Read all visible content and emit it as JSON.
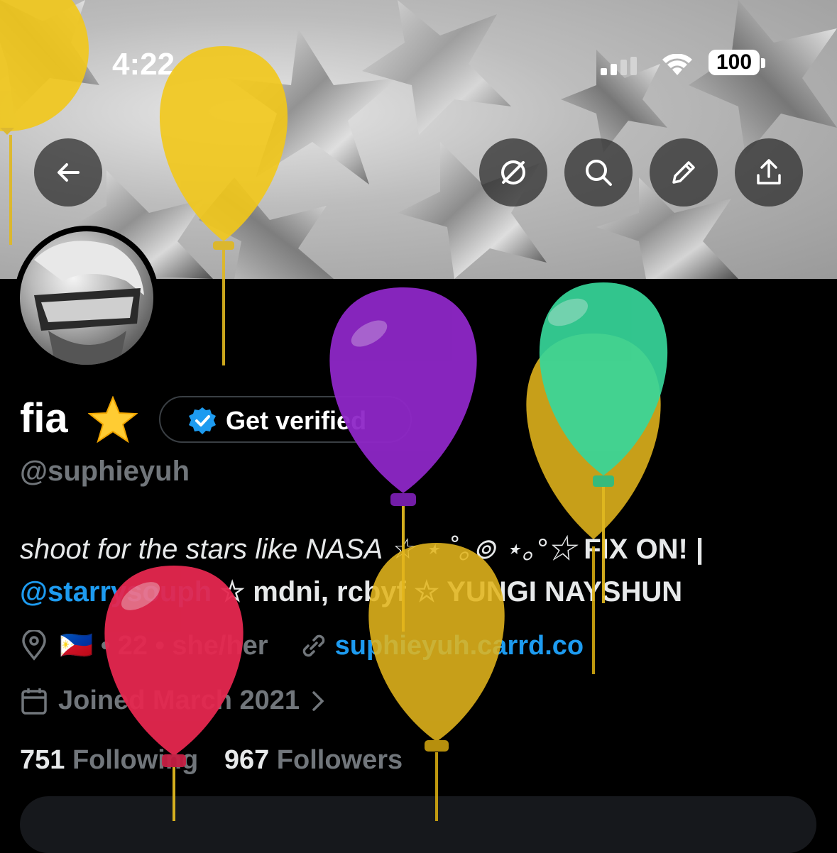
{
  "status_bar": {
    "time": "4:22",
    "battery": "100"
  },
  "profile": {
    "name": "fia",
    "name_emoji": "⭐",
    "get_verified_label": "Get verified",
    "handle": "@suphieyuh",
    "bio_line1_italic": "shoot for the stars like NASA ☆ ⋆ ˚｡⊚ ⋆｡°☆",
    "bio_line1_bold": " FIX ON! |",
    "bio_line2_link": "@starrysouph",
    "bio_line2_rest": " ☆ mdni, rcbyf ☆ YUNGI NAYSHUN",
    "location": "🇵🇭 • 22 • she/her",
    "website": "suphieyuh.carrd.co",
    "joined": "Joined March 2021",
    "following_count": "751",
    "following_label": "Following",
    "followers_count": "967",
    "followers_label": "Followers"
  },
  "icons": [
    "back-arrow-icon",
    "circle-slash-icon",
    "search-icon",
    "pencil-icon",
    "share-icon",
    "location-pin-icon",
    "link-icon",
    "calendar-icon",
    "chevron-right-icon",
    "verified-badge-icon"
  ],
  "colors": {
    "accent": "#1d9bf0",
    "muted": "#71767b",
    "text": "#e7e9ea",
    "background": "#000000"
  }
}
